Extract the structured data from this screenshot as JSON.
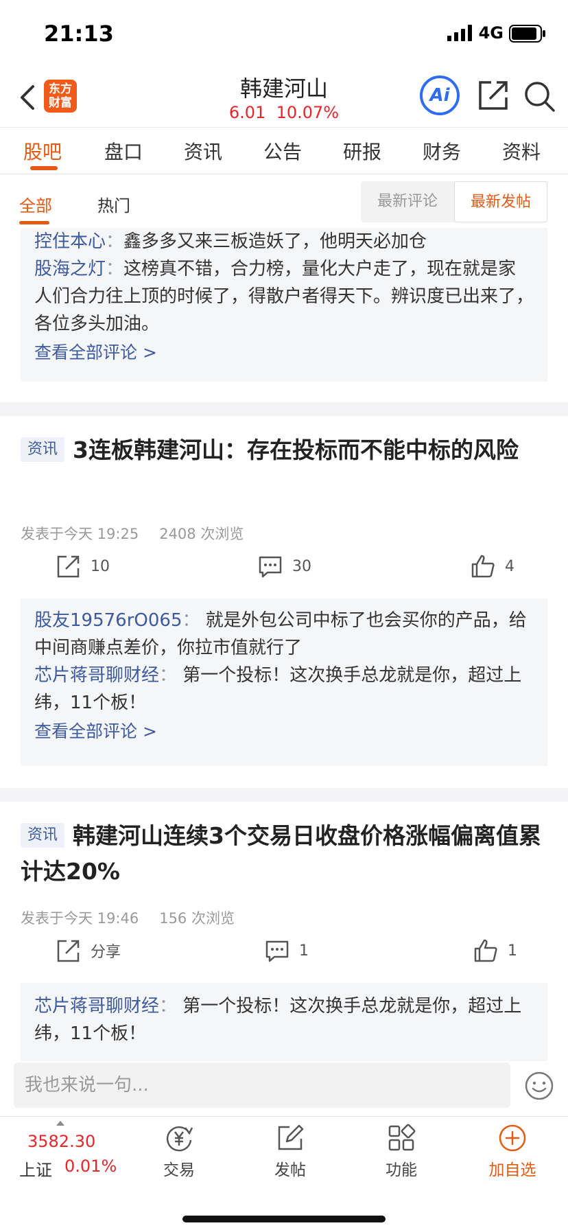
{
  "status_bar": {
    "time": "21:13",
    "network": "4G"
  },
  "header": {
    "logo_text": "东方财富",
    "logo_line1": "东方",
    "logo_line2": "财富",
    "stock_name": "韩建河山",
    "price": "6.01",
    "change_pct": "10.07%",
    "ai_label": "Ai",
    "accent_color": "#e45a13",
    "up_color": "#e7262b"
  },
  "tabs": [
    "股吧",
    "盘口",
    "资讯",
    "公告",
    "研报",
    "财务",
    "资料"
  ],
  "subfilter": {
    "all": "全部",
    "hot": "热门",
    "latest_comment": "最新评论",
    "latest_post": "最新发帖"
  },
  "top_comments": [
    {
      "user": "控住本心",
      "text": "鑫多多又来三板造妖了，他明天必加仓"
    },
    {
      "user": "股海之灯",
      "text": "这榜真不错，合力榜，量化大户走了，现在就是家人们合力往上顶的时候了，得散户者得天下。辨识度已出来了，各位多头加油。"
    }
  ],
  "view_all": "查看全部评论 >",
  "posts": [
    {
      "badge": "资讯",
      "title": "3连板韩建河山：存在投标而不能中标的风险",
      "posted": "发表于今天 19:25",
      "views": "2408 次浏览",
      "share": "10",
      "comments": "30",
      "likes": "4",
      "comment_list": [
        {
          "user": "股友19576rO065",
          "text": "就是外包公司中标了也会买你的产品，给中间商赚点差价，你拉市值就行了"
        },
        {
          "user": "芯片蒋哥聊财经",
          "text": "第一个投标！这次换手总龙就是你，超过上纬，11个板！"
        }
      ]
    },
    {
      "badge": "资讯",
      "title": "韩建河山连续3个交易日收盘价格涨幅偏离值累计达20%",
      "posted": "发表于今天 19:46",
      "views": "156 次浏览",
      "share": "分享",
      "comments": "1",
      "likes": "1",
      "comment_list": [
        {
          "user": "芯片蒋哥聊财经",
          "text": "第一个投标！这次换手总龙就是你，超过上纬，11个板！"
        }
      ]
    }
  ],
  "input": {
    "placeholder": "我也来说一句..."
  },
  "bottom_nav": {
    "index_value": "3582.30",
    "index_name": "上证",
    "index_pct": "0.01%",
    "items": [
      "交易",
      "发帖",
      "功能",
      "加自选"
    ]
  }
}
